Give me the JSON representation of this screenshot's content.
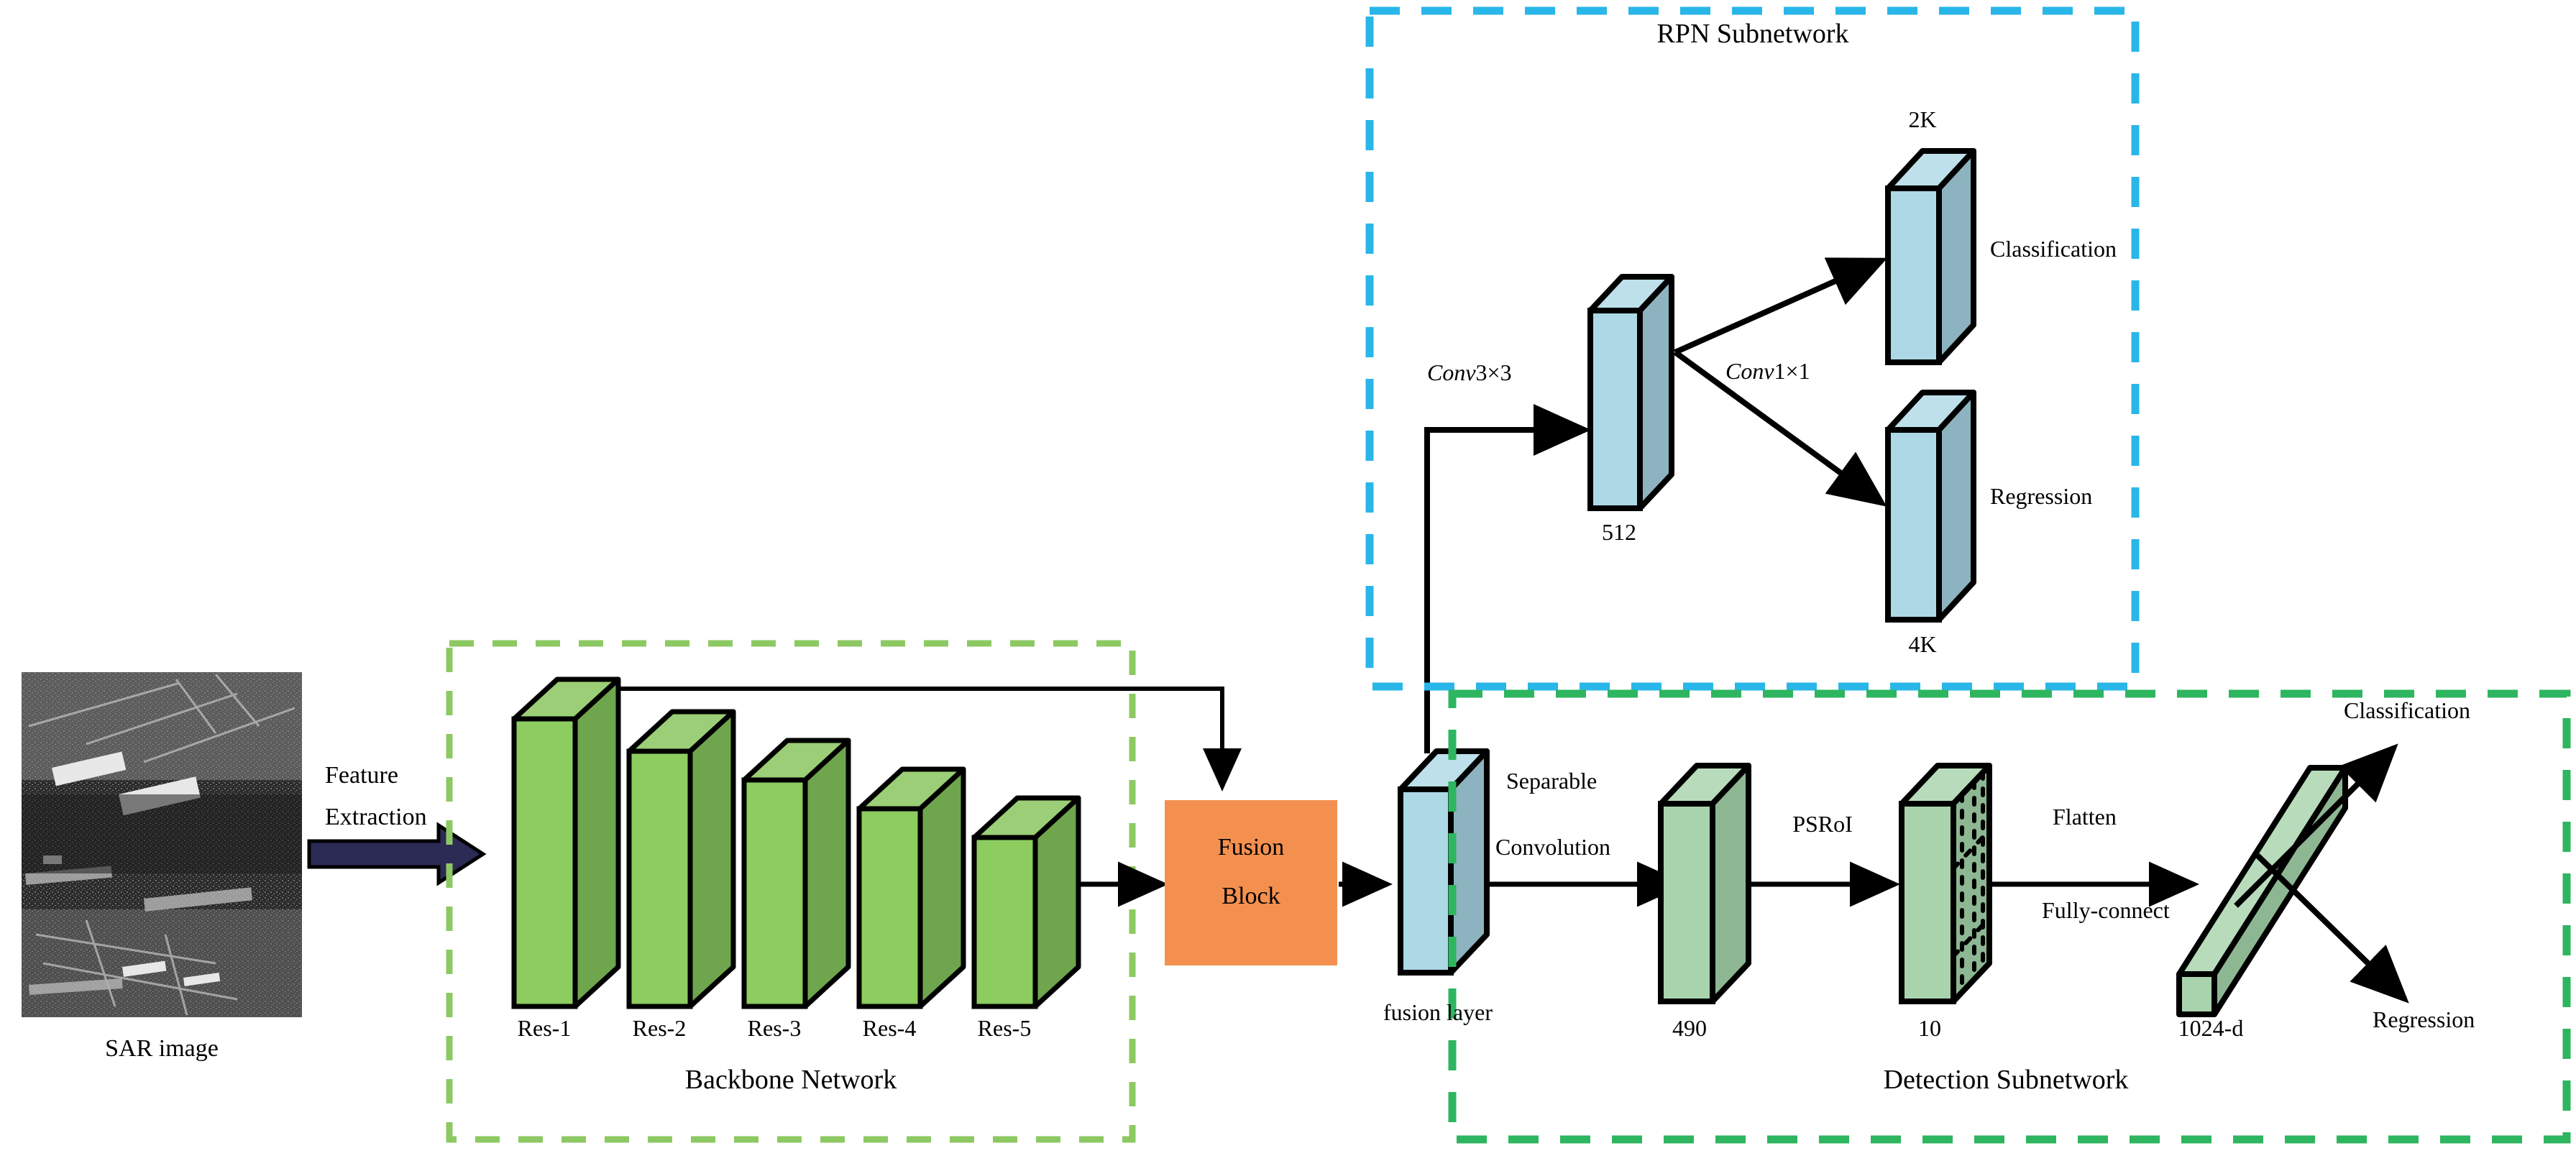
{
  "diagram": {
    "title": "SAR ship detection network architecture",
    "colors": {
      "backbone_border": "#8DC963",
      "rpn_border": "#29B6E8",
      "detection_border": "#2EB55F",
      "fusion_block": "#F4904F",
      "res_front": "#8DCC5F",
      "res_side": "#6FA54D",
      "res_top": "#9BCE76",
      "blue_front": "#ADD8E6",
      "blue_side": "#8EB3C0",
      "blue_top": "#BDE0EA",
      "det_front": "#A9D3AC",
      "det_side": "#8DB792",
      "det_top": "#B8DCBB",
      "arrow_navy": "#2B2B55",
      "stroke": "#000000"
    },
    "input": {
      "image_caption": "SAR image",
      "arrow_label_line1": "Feature",
      "arrow_label_line2": "Extraction"
    },
    "backbone": {
      "title": "Backbone Network",
      "blocks": [
        {
          "label": "Res-1"
        },
        {
          "label": "Res-2"
        },
        {
          "label": "Res-3"
        },
        {
          "label": "Res-4"
        },
        {
          "label": "Res-5"
        }
      ]
    },
    "fusion": {
      "block_line1": "Fusion",
      "block_line2": "Block",
      "layer_label": "fusion layer"
    },
    "rpn": {
      "title": "RPN Subnetwork",
      "conv_in_italic": "Conv",
      "conv_in_kernel": "3×3",
      "conv_out_italic": "Conv",
      "conv_out_kernel": "1×1",
      "feature_label": "512",
      "cls_top_label": "2K",
      "cls_side_label": "Classification",
      "reg_bottom_label": "4K",
      "reg_side_label": "Regression"
    },
    "detection": {
      "title": "Detection Subnetwork",
      "sep_conv_line1": "Separable",
      "sep_conv_line2": "Convolution",
      "block1_label": "490",
      "psroi_label": "PSRoI",
      "block2_label": "10",
      "flatten_label": "Flatten",
      "fc_label": "Fully-connect",
      "fc_block_label": "1024-d",
      "out_cls_label": "Classification",
      "out_reg_label": "Regression"
    }
  }
}
